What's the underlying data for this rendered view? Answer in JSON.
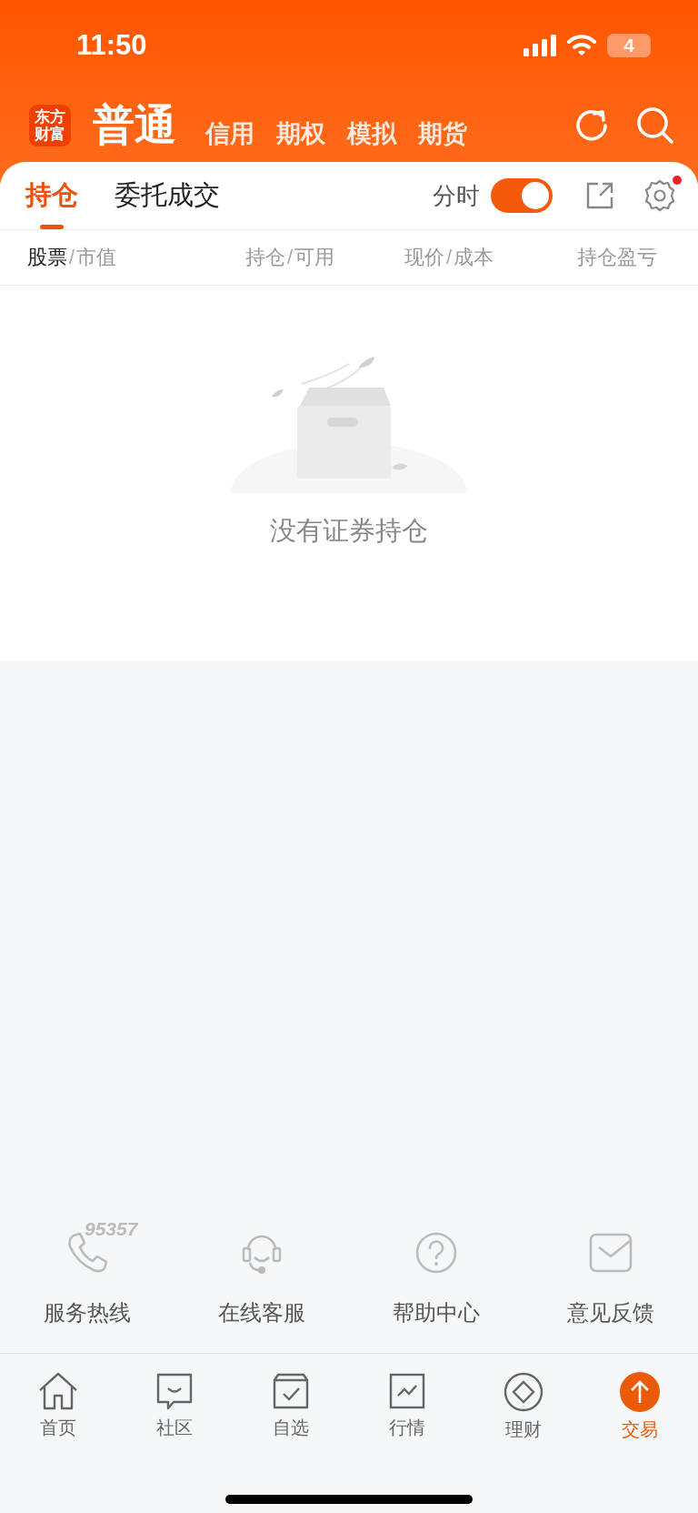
{
  "status_bar": {
    "time": "11:50",
    "battery": "4"
  },
  "logo": [
    "东方",
    "财富"
  ],
  "account_tabs": [
    {
      "label": "普通",
      "selected": true
    },
    {
      "label": "信用",
      "selected": false
    },
    {
      "label": "期权",
      "selected": false
    },
    {
      "label": "模拟",
      "selected": false
    },
    {
      "label": "期货",
      "selected": false
    }
  ],
  "sub_tabs": [
    {
      "label": "持仓",
      "selected": true
    },
    {
      "label": "委托成交",
      "selected": false
    }
  ],
  "timeshare_toggle": {
    "label": "分时",
    "on": true
  },
  "settings_badge": true,
  "columns": [
    {
      "primary": "股票",
      "separator": "/",
      "secondary": "市值",
      "highlighted": true
    },
    {
      "primary": "持仓",
      "separator": "/",
      "secondary": "可用",
      "highlighted": false
    },
    {
      "primary": "现价",
      "separator": "/",
      "secondary": "成本",
      "highlighted": false
    },
    {
      "primary": "持仓盈亏",
      "highlighted": false
    }
  ],
  "empty_message": "没有证券持仓",
  "services": [
    {
      "label": "服务热线",
      "badge": "95357"
    },
    {
      "label": "在线客服"
    },
    {
      "label": "帮助中心"
    },
    {
      "label": "意见反馈"
    }
  ],
  "nav": [
    {
      "label": "首页",
      "selected": false
    },
    {
      "label": "社区",
      "selected": false
    },
    {
      "label": "自选",
      "selected": false
    },
    {
      "label": "行情",
      "selected": false
    },
    {
      "label": "理财",
      "selected": false
    },
    {
      "label": "交易",
      "selected": true
    }
  ]
}
